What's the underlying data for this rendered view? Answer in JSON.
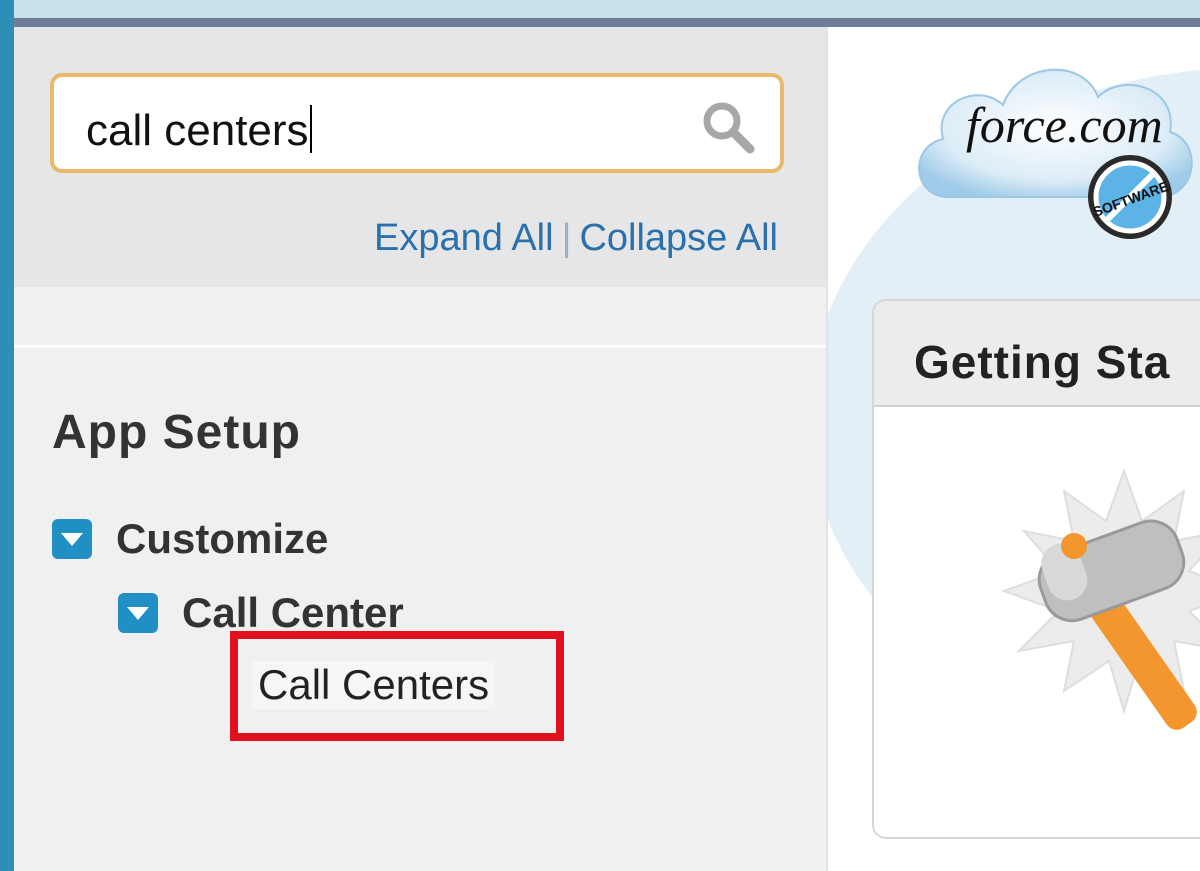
{
  "search": {
    "value": "call centers"
  },
  "sidebar": {
    "expand_all": "Expand All",
    "separator": "|",
    "collapse_all": "Collapse All",
    "section_title": "App Setup",
    "tree": {
      "customize": "Customize",
      "call_center": "Call Center",
      "call_centers": "Call Centers"
    }
  },
  "main": {
    "logo_text": "force.com",
    "logo_badge": "SOFTWARE",
    "card_title": "Getting Sta"
  },
  "colors": {
    "link": "#2a70ad",
    "toggle": "#1f8fc4",
    "highlight": "#e1101e",
    "search_border": "#e8b96b"
  }
}
